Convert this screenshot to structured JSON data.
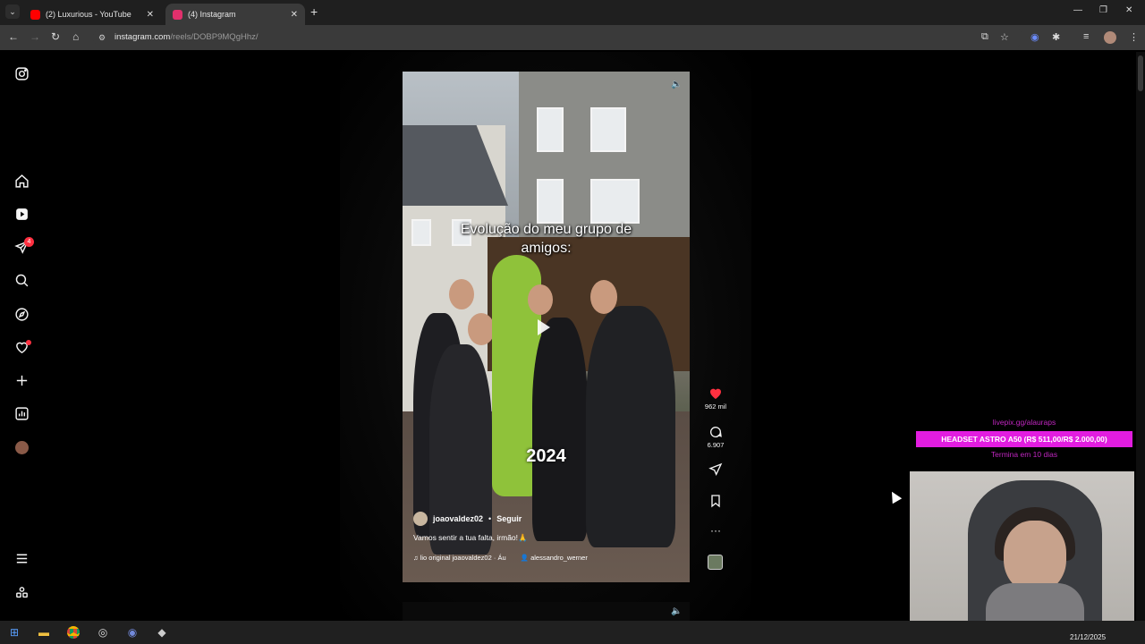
{
  "browser": {
    "tabs": [
      {
        "title": "(2) Luxurious - YouTube",
        "favicon": "youtube-icon",
        "color": "#ff0000"
      },
      {
        "title": "(4) Instagram",
        "favicon": "instagram-icon",
        "color": "#e1306c"
      }
    ],
    "url_host": "instagram.com",
    "url_path": "/reels/DOBP9MQgHhz/"
  },
  "sidebar": {
    "notification_count": "4",
    "items": [
      "instagram-logo-icon",
      "home-icon",
      "reels-icon",
      "messages-icon",
      "search-icon",
      "explore-icon",
      "notifications-icon",
      "create-icon",
      "dashboard-icon",
      "profile-avatar",
      "more-icon",
      "threads-icon"
    ]
  },
  "reel": {
    "overlay_text": "Evolução do meu grupo de amigos:",
    "year": "2024",
    "username": "joaovaldez02",
    "follow_label": "Seguir",
    "caption": "Vamos sentir a tua falta, irmão!🙏",
    "audio": "lio original  joaovaldez02 · Áu",
    "tagged_user": "alessandro_werner",
    "likes": "962 mil",
    "comments": "6.907"
  },
  "stream_overlay": {
    "link": "livepix.gg/alauraps",
    "goal": "HEADSET ASTRO A50 (R$ 511,00/R$ 2.000,00)",
    "ends": "Termina em 10 dias"
  },
  "taskbar": {
    "date": "21/12/2025"
  }
}
